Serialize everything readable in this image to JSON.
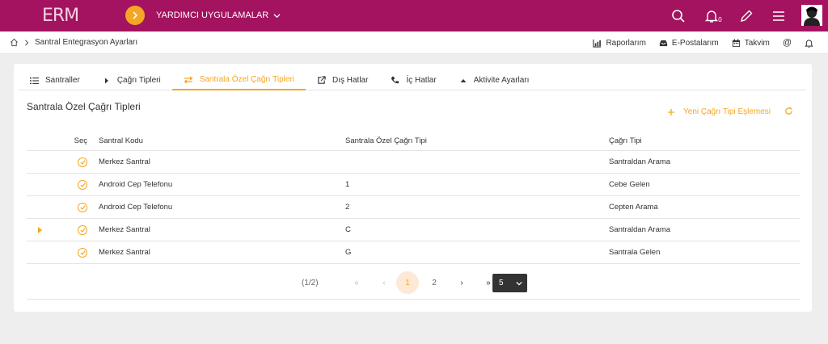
{
  "header": {
    "logo": "ERM",
    "apps_label": "YARDIMCI UYGULAMALAR",
    "notification_count": "0"
  },
  "breadcrumb": {
    "title": "Santral Entegrasyon Ayarları"
  },
  "quick_links": [
    {
      "label": "Raporlarım",
      "icon": "chart-icon"
    },
    {
      "label": "E-Postalarım",
      "icon": "inbox-icon"
    },
    {
      "label": "Takvim",
      "icon": "calendar-icon"
    }
  ],
  "tabs": [
    {
      "label": "Santraller",
      "icon": "list-icon"
    },
    {
      "label": "Çağrı Tipleri",
      "icon": "caret-right-icon"
    },
    {
      "label": "Santrala Özel Çağrı Tipleri",
      "icon": "swap-icon",
      "active": true
    },
    {
      "label": "Dış Hatlar",
      "icon": "external-link-icon"
    },
    {
      "label": "İç Hatlar",
      "icon": "phone-icon"
    },
    {
      "label": "Aktivite Ayarları",
      "icon": "caret-up-icon"
    }
  ],
  "panel": {
    "title": "Santrala Özel Çağrı Tipleri",
    "new_button": "Yeni Çağrı Tipi Eşlemesi"
  },
  "table": {
    "columns": [
      "Seç",
      "Santral Kodu",
      "Santrala Özel Çağrı Tipi",
      "Çağrı Tipi"
    ],
    "rows": [
      {
        "code": "Merkez Santral",
        "special": "",
        "type": "Santraldan Arama",
        "current": false
      },
      {
        "code": "Android Cep Telefonu",
        "special": "1",
        "type": "Cebe Gelen",
        "current": false
      },
      {
        "code": "Android Cep Telefonu",
        "special": "2",
        "type": "Cepten Arama",
        "current": false
      },
      {
        "code": "Merkez Santral",
        "special": "C",
        "type": "Santraldan Arama",
        "current": true
      },
      {
        "code": "Merkez Santral",
        "special": "G",
        "type": "Santrala Gelen",
        "current": false
      }
    ]
  },
  "pager": {
    "summary": "(1/2)",
    "first": "«",
    "prev": "‹",
    "next": "›",
    "last": "»",
    "pages": [
      "1",
      "2"
    ],
    "current_page": "1",
    "rows_per_page": "5"
  },
  "colors": {
    "brand": "#a3135f",
    "accent": "#f5a623"
  }
}
